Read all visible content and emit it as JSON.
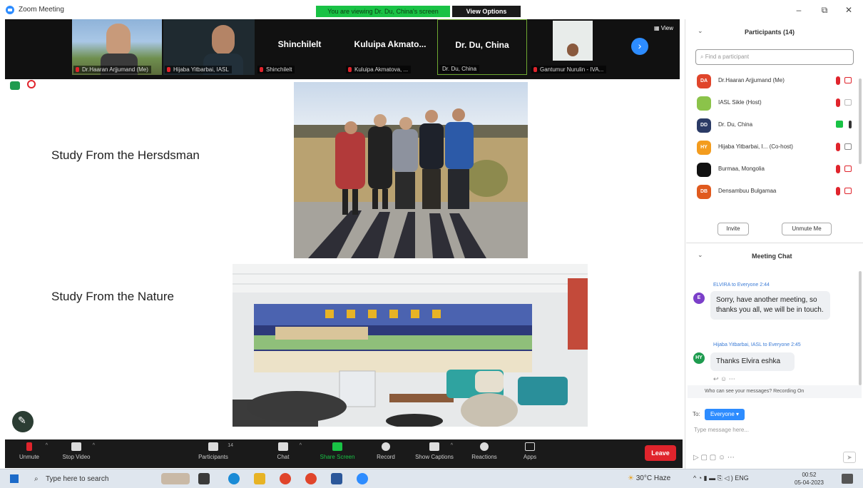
{
  "titlebar": {
    "app_title": "Zoom Meeting",
    "share_banner": "You are viewing Dr. Du, China's screen",
    "view_options": "View Options",
    "minimize": "–",
    "restore": "⧉",
    "close": "✕"
  },
  "video_strip": {
    "tiles": [
      {
        "label": "Dr.Haaran Arjjumand (Me)"
      },
      {
        "label": "Hijaba Yitbarbai, IASL"
      },
      {
        "big": "Shinchilelt",
        "label": "Shinchilelt"
      },
      {
        "big": "Kuluipa Akmato...",
        "label": "Kuluipa Akmatova, ..."
      },
      {
        "big": "Dr. Du, China",
        "label": "Dr. Du, China"
      },
      {
        "label": "Gantumur Nurulin - IVA..."
      }
    ],
    "view_label": "View"
  },
  "slide": {
    "line1": "Study From the Hersdsman",
    "line2": "Study From the Nature"
  },
  "toolbar": {
    "items": [
      {
        "label": "Unmute"
      },
      {
        "label": "Stop Video"
      },
      {
        "label": "Participants",
        "count": "14"
      },
      {
        "label": "Chat"
      },
      {
        "label": "Share Screen"
      },
      {
        "label": "Record"
      },
      {
        "label": "Show Captions"
      },
      {
        "label": "Reactions"
      },
      {
        "label": "Apps"
      }
    ],
    "leave": "Leave"
  },
  "participants_panel": {
    "title": "Participants (14)",
    "search_placeholder": "Find a participant",
    "rows": [
      {
        "initials": "DA",
        "color": "#e0452b",
        "name": "Dr.Haaran Arjjumand (Me)"
      },
      {
        "initials": "",
        "color": "#8bc34a",
        "name": "IASL Sikle (Host)"
      },
      {
        "initials": "DD",
        "color": "#2b3b66",
        "name": "Dr. Du, China"
      },
      {
        "initials": "HY",
        "color": "#f39c1e",
        "name": "Hijaba Yitbarbai, I... (Co-host)"
      },
      {
        "initials": "",
        "color": "#111111",
        "name": "Burmaa, Mongolia"
      },
      {
        "initials": "DB",
        "color": "#e05a1e",
        "name": "Densambuu Bulgamaa"
      }
    ],
    "invite": "Invite",
    "unmute_me": "Unmute Me"
  },
  "chat_panel": {
    "title": "Meeting Chat",
    "messages": [
      {
        "initial": "E",
        "color": "#7b3fc9",
        "meta": "ELVIRA to Everyone 2:44",
        "text": "Sorry, have another meeting, so thanks you all, we will be in touch."
      },
      {
        "initial": "HY",
        "color": "#1e9b4f",
        "meta": "Hijaba Yitbarbai, IASL to Everyone 2:45",
        "text": "Thanks Elvira eshka"
      }
    ],
    "who_can_see": "Who can see your messages? Recording On",
    "to_label": "To:",
    "to_value": "Everyone",
    "type_placeholder": "Type message here..."
  },
  "taskbar": {
    "search": "Type here to search",
    "weather": "30°C Haze",
    "lang": "ENG",
    "time": "00:52",
    "date": "05-04-2023"
  }
}
